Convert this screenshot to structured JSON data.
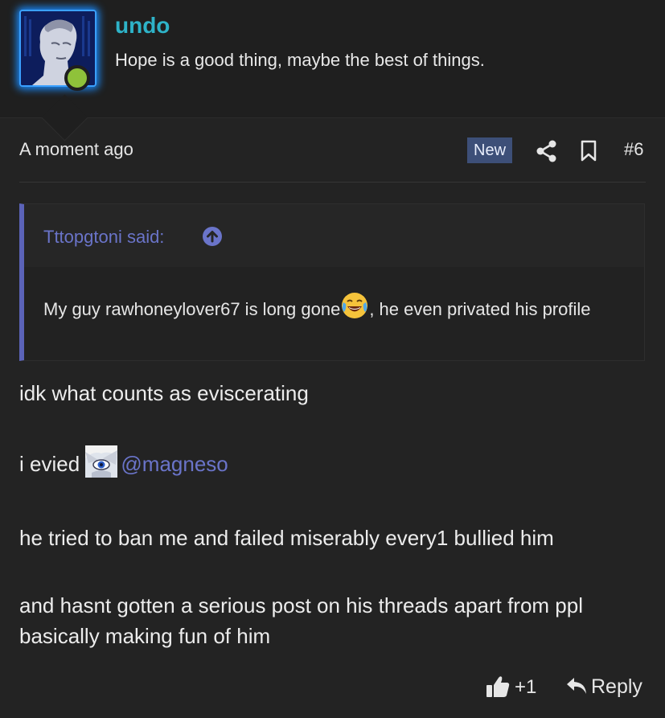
{
  "user": {
    "name": "undo",
    "title": "Hope is a good thing, maybe the best of things.",
    "status": "online",
    "avatar_icon": "statue-avatar"
  },
  "post": {
    "time": "A moment ago",
    "badge": "New",
    "number": "#6"
  },
  "quote": {
    "author": "Tttopgtoni said:",
    "text_before_emoji": "My guy rawhoneylover67 is long gone",
    "emoji": "crying-laughing-emoji",
    "text_after_emoji": ", he even privated his profile"
  },
  "body": {
    "line1": "idk what counts as eviscerating",
    "line2_prefix": "i evied",
    "mention": "@magneso",
    "line3": "he tried to ban me and failed miserably every1 bullied him",
    "line4": "and hasnt gotten a serious post on his threads apart from ppl basically making fun of him"
  },
  "footer": {
    "like_count": "+1",
    "reply_label": "Reply"
  },
  "colors": {
    "username": "#2eb3c8",
    "accent": "#6a74c9",
    "online": "#8fc23a",
    "new_badge": "#3d4f78"
  }
}
